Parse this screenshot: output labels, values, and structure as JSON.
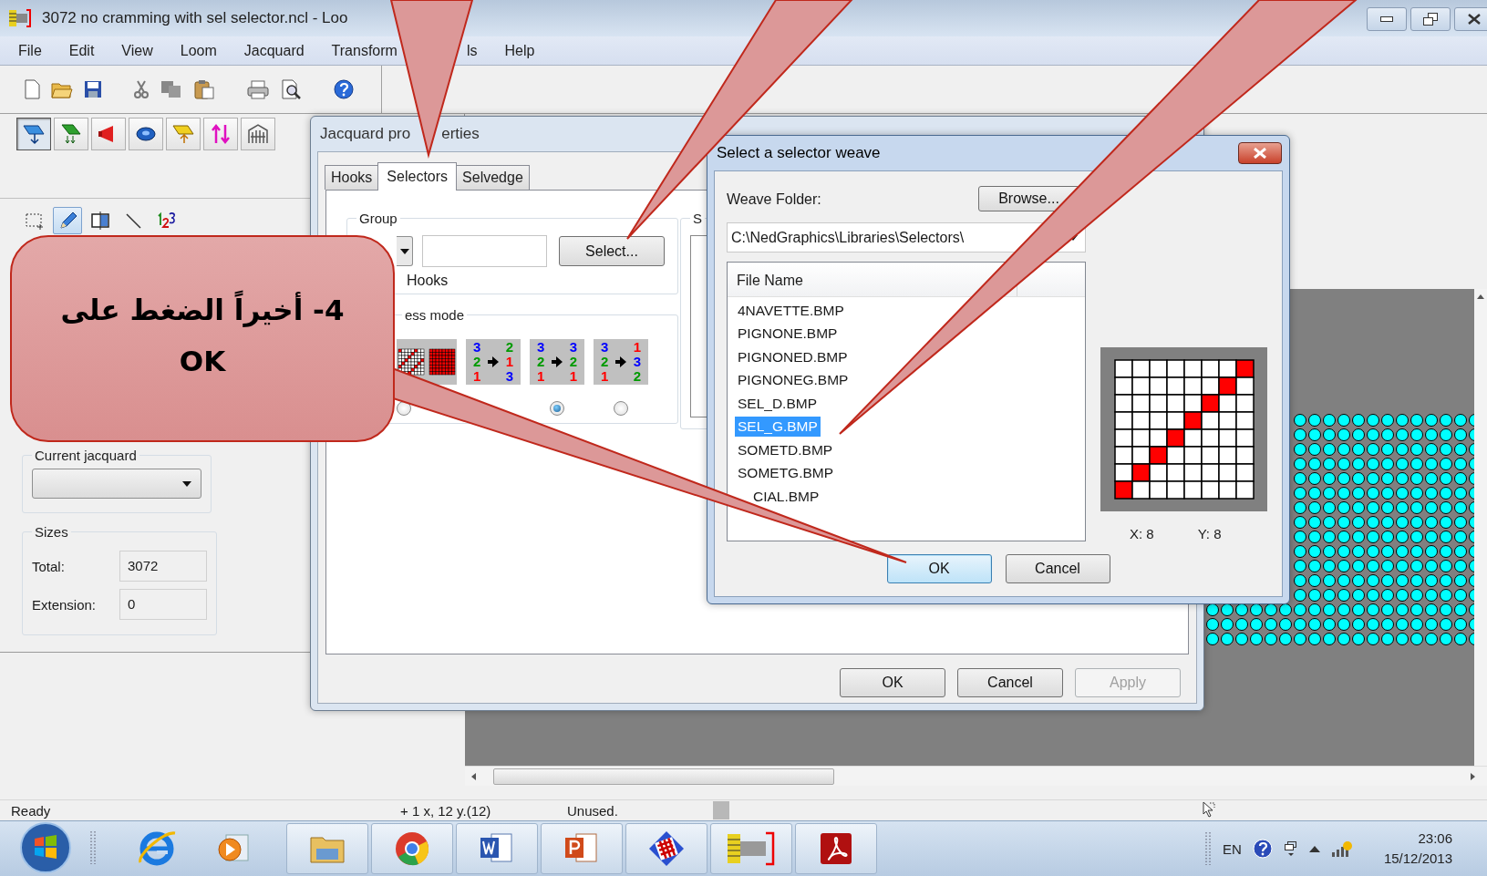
{
  "window": {
    "title": "3072 no cramming with sel selector.ncl - Loo"
  },
  "menu": [
    {
      "label": "File"
    },
    {
      "label": "Edit"
    },
    {
      "label": "View"
    },
    {
      "label": "Loom"
    },
    {
      "label": "Jacquard"
    },
    {
      "label": "Transform"
    },
    {
      "label": "ls"
    },
    {
      "label": "Help"
    }
  ],
  "mode_toolbar": [
    {
      "pressed": true
    },
    {
      "pressed": false
    },
    {
      "pressed": false
    },
    {
      "pressed": false
    },
    {
      "pressed": false
    },
    {
      "pressed": false
    },
    {
      "pressed": false
    }
  ],
  "drawing_tools": [
    {
      "selected": false
    },
    {
      "selected": true
    },
    {
      "selected": false
    },
    {
      "selected": false
    },
    {
      "selected": false
    }
  ],
  "current_jacquard": {
    "label": "Current jacquard"
  },
  "sizes": {
    "label": "Sizes",
    "fields": [
      {
        "label": "Total:",
        "value": "3072"
      },
      {
        "label": "Extension:",
        "value": "0"
      }
    ]
  },
  "jacquard_dialog": {
    "title_parts": [
      "Jacquard pro",
      "erties"
    ],
    "tabs": [
      {
        "label": "Hooks",
        "selected": false
      },
      {
        "label": "Selectors",
        "selected": true
      },
      {
        "label": "Selvedge",
        "selected": false
      }
    ],
    "group": {
      "label": "Group",
      "button": "Select...",
      "hooks_label": "Hooks"
    },
    "mode": {
      "label": "ess mode",
      "options": [
        {
          "kind": "grid",
          "selected": false
        },
        {
          "kind": "order",
          "from": [
            {
              "text": "3",
              "color": "#0000ff"
            },
            {
              "text": "2",
              "color": "#009a00"
            },
            {
              "text": "1",
              "color": "#ff0000"
            }
          ],
          "to": [
            {
              "text": "2",
              "color": "#009a00"
            },
            {
              "text": "1",
              "color": "#ff0000"
            },
            {
              "text": "3",
              "color": "#0000ff"
            }
          ]
        },
        {
          "kind": "order",
          "selected": true,
          "from": [
            {
              "text": "3",
              "color": "#0000ff"
            },
            {
              "text": "2",
              "color": "#009a00"
            },
            {
              "text": "1",
              "color": "#ff0000"
            }
          ],
          "to": [
            {
              "text": "3",
              "color": "#0000ff"
            },
            {
              "text": "2",
              "color": "#009a00"
            },
            {
              "text": "1",
              "color": "#ff0000"
            }
          ]
        },
        {
          "kind": "order",
          "selected": false,
          "from": [
            {
              "text": "3",
              "color": "#0000ff"
            },
            {
              "text": "2",
              "color": "#009a00"
            },
            {
              "text": "1",
              "color": "#ff0000"
            }
          ],
          "to": [
            {
              "text": "1",
              "color": "#ff0000"
            },
            {
              "text": "3",
              "color": "#0000ff"
            },
            {
              "text": "2",
              "color": "#009a00"
            }
          ]
        }
      ]
    },
    "side_group_label": "S",
    "buttons": [
      {
        "label": "OK",
        "disabled": false
      },
      {
        "label": "Cancel",
        "disabled": false
      },
      {
        "label": "Apply",
        "disabled": true
      }
    ]
  },
  "selector_dialog": {
    "title": "Select a selector weave",
    "folder_label": "Weave Folder:",
    "browse": "Browse...",
    "folder_path": "C:\\NedGraphics\\Libraries\\Selectors\\",
    "list_header": "File Name",
    "files": [
      {
        "name": "4NAVETTE.BMP",
        "selected": false
      },
      {
        "name": "PIGNONE.BMP",
        "selected": false
      },
      {
        "name": "PIGNONED.BMP",
        "selected": false
      },
      {
        "name": "PIGNONEG.BMP",
        "selected": false
      },
      {
        "name": "SEL_D.BMP",
        "selected": false
      },
      {
        "name": "SEL_G.BMP",
        "selected": true
      },
      {
        "name": "SOMETD.BMP",
        "selected": false
      },
      {
        "name": "SOMETG.BMP",
        "selected": false
      },
      {
        "name": "CIAL.BMP",
        "selected": false,
        "kind": "partial"
      }
    ],
    "x_label": "X:  8",
    "y_label": "Y:  8",
    "buttons": [
      {
        "label": "OK",
        "default": true
      },
      {
        "label": "Cancel",
        "default": false
      }
    ]
  },
  "callout": {
    "lines": [
      "4- أخيراً الضغط على",
      "OK"
    ]
  },
  "status_bar": {
    "message": "Ready",
    "position": "+ 1 x, 12 y.(12)",
    "info": "Unused."
  },
  "taskbar": {
    "language": "EN",
    "time": "23:06",
    "date": "15/12/2013"
  }
}
